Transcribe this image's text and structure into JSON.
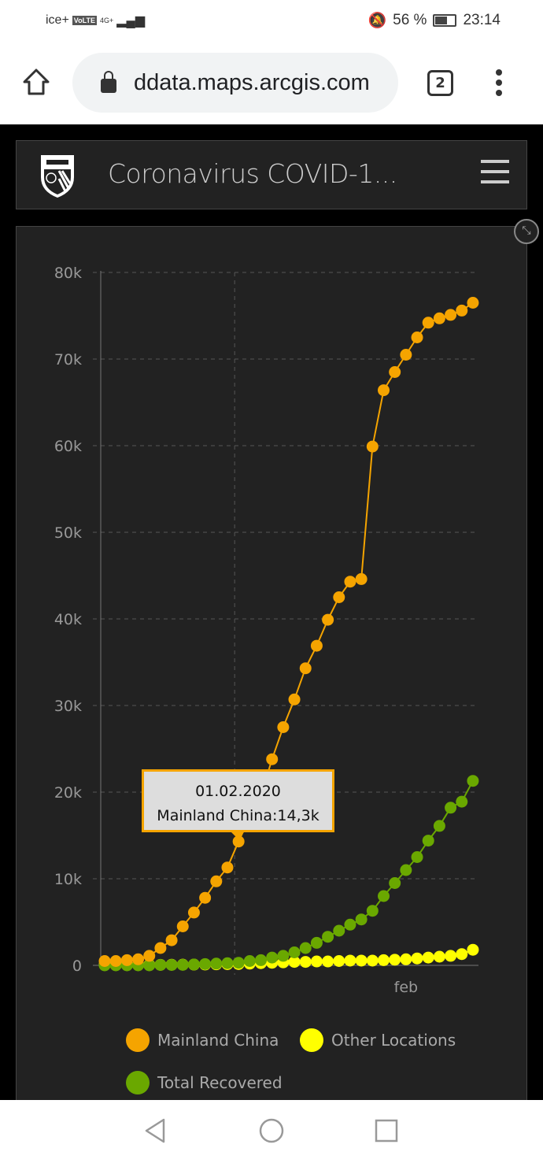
{
  "status_bar": {
    "carrier": "ice+",
    "volte": "VoLTE",
    "network": "4G+",
    "battery": "56 %",
    "battery_level": 0.56,
    "time": "23:14"
  },
  "browser": {
    "url": "ddata.maps.arcgis.com",
    "tab_count": "2"
  },
  "app": {
    "title": "Coronavirus COVID-1..."
  },
  "tooltip": {
    "date": "01.02.2020",
    "text": "Mainland China:14,3k"
  },
  "legend": [
    {
      "label": "Mainland China",
      "color": "#f5a400"
    },
    {
      "label": "Other Locations",
      "color": "#ffff00"
    },
    {
      "label": "Total Recovered",
      "color": "#6aa800"
    }
  ],
  "chart_data": {
    "type": "line",
    "y_ticks": [
      "0",
      "10k",
      "20k",
      "30k",
      "40k",
      "50k",
      "60k",
      "70k",
      "80k"
    ],
    "ylim": [
      0,
      80000
    ],
    "x_tick_labels": [
      {
        "label": "feb",
        "index": 27
      }
    ],
    "grid": true,
    "legend_position": "bottom",
    "highlighted_index": 12,
    "series": [
      {
        "name": "Mainland China",
        "color": "#f5a400",
        "values": [
          500,
          500,
          600,
          700,
          1100,
          2000,
          2900,
          4500,
          6100,
          7800,
          9700,
          11300,
          14300,
          17100,
          19600,
          23800,
          27500,
          30700,
          34300,
          36900,
          39900,
          42500,
          44300,
          44600,
          59900,
          66400,
          68500,
          70500,
          72500,
          74200,
          74700,
          75100,
          75600,
          76500
        ]
      },
      {
        "name": "Other Locations",
        "color": "#ffff00",
        "values": [
          100,
          50,
          50,
          50,
          50,
          60,
          70,
          80,
          90,
          100,
          120,
          140,
          150,
          200,
          250,
          300,
          350,
          400,
          400,
          450,
          450,
          500,
          550,
          550,
          550,
          600,
          650,
          700,
          800,
          900,
          1000,
          1100,
          1300,
          1800
        ]
      },
      {
        "name": "Total Recovered",
        "color": "#6aa800",
        "values": [
          0,
          0,
          0,
          0,
          0,
          50,
          50,
          60,
          100,
          150,
          200,
          250,
          300,
          500,
          600,
          900,
          1100,
          1500,
          2000,
          2600,
          3300,
          4000,
          4700,
          5300,
          6300,
          8000,
          9500,
          11000,
          12500,
          14400,
          16100,
          18200,
          18900,
          21300
        ]
      }
    ]
  }
}
